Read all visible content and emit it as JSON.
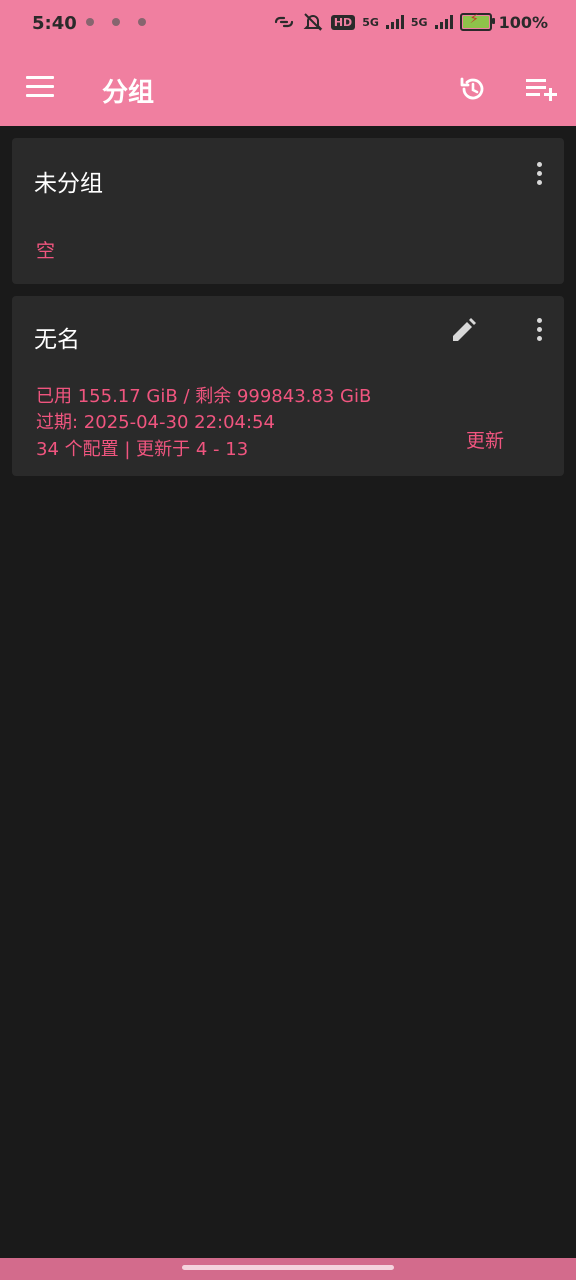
{
  "status_bar": {
    "time": "5:40",
    "hd_badge": "HD",
    "signal1": "5G",
    "signal2": "5G",
    "battery_text": "100%"
  },
  "toolbar": {
    "title": "分组",
    "icons": [
      "menu-icon",
      "history-icon",
      "playlist-add-icon"
    ]
  },
  "groups": [
    {
      "name": "未分组",
      "status": "空"
    },
    {
      "name": "无名",
      "usage": "已用 155.17 GiB / 剩余 999843.83 GiB",
      "expire": "过期: 2025-04-30 22:04:54",
      "summary": "34 个配置 | 更新于 4 - 13",
      "update_label": "更新"
    }
  ],
  "colors": {
    "accent": "#f07fa0",
    "accent_text": "#f0557f",
    "background": "#1a1a1a",
    "card": "#2a2a2a"
  }
}
